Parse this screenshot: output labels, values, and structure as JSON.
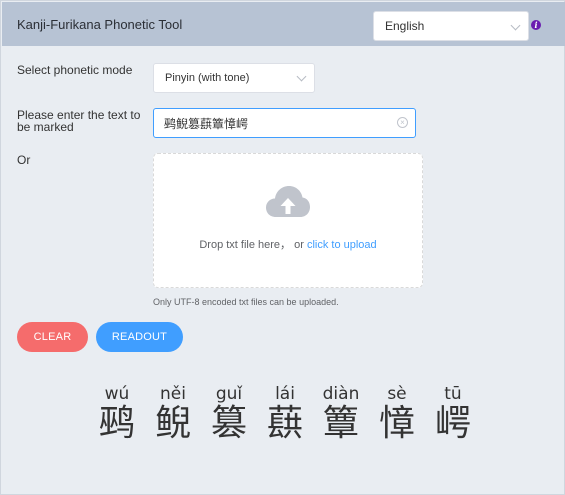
{
  "header": {
    "title": "Kanji-Furikana Phonetic Tool",
    "language": "English"
  },
  "form": {
    "mode_label": "Select phonetic mode",
    "mode_value": "Pinyin (with tone)",
    "text_label": "Please enter the text to be marked",
    "text_value": "鹀鲵篡蕻簟慞崿",
    "or_label": "Or",
    "upload": {
      "drop_text": "Drop txt file here， or ",
      "click_text": "click to upload",
      "tip": "Only UTF-8 encoded txt files can be uploaded."
    }
  },
  "buttons": {
    "clear": "CLEAR",
    "readout": "READOUT"
  },
  "result": [
    {
      "hanzi": "鹀",
      "pinyin": "wú"
    },
    {
      "hanzi": "鲵",
      "pinyin": "něi"
    },
    {
      "hanzi": "篡",
      "pinyin": "guǐ"
    },
    {
      "hanzi": "蕻",
      "pinyin": "lái"
    },
    {
      "hanzi": "簟",
      "pinyin": "diàn"
    },
    {
      "hanzi": "慞",
      "pinyin": "sè"
    },
    {
      "hanzi": "崿",
      "pinyin": "tū"
    }
  ],
  "colors": {
    "header_bg": "#b7c3d4",
    "page_bg": "#e9edf2",
    "primary": "#409eff",
    "danger": "#f56c6c",
    "info_icon": "#6a1bb0"
  },
  "icons": {
    "info": "info-icon",
    "upload": "cloud-upload-icon",
    "select_arrow": "chevron-down-icon",
    "clear_input": "circle-close-icon"
  }
}
